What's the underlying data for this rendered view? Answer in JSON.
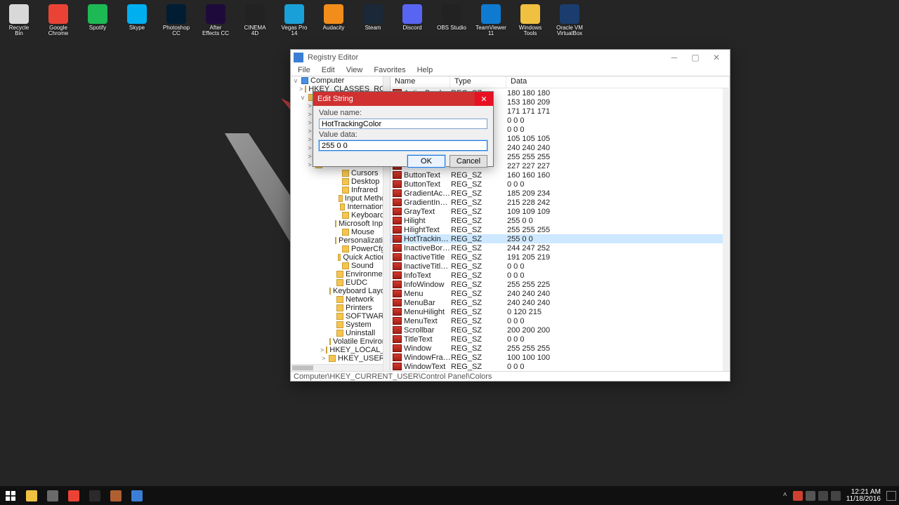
{
  "desktop_icons": [
    {
      "label": "Recycle Bin",
      "color": "#d8d8d8"
    },
    {
      "label": "Google Chrome",
      "color": "#ea4335"
    },
    {
      "label": "Spotify",
      "color": "#1db954"
    },
    {
      "label": "Skype",
      "color": "#00aff0"
    },
    {
      "label": "Photoshop CC",
      "color": "#001d34"
    },
    {
      "label": "After Effects CC",
      "color": "#1f0a3c"
    },
    {
      "label": "CINEMA 4D",
      "color": "#222"
    },
    {
      "label": "Vegas Pro 14",
      "color": "#1aa0d8"
    },
    {
      "label": "Audacity",
      "color": "#f28c1a"
    },
    {
      "label": "Steam",
      "color": "#1b2838"
    },
    {
      "label": "Discord",
      "color": "#5865f2"
    },
    {
      "label": "OBS Studio",
      "color": "#222"
    },
    {
      "label": "TeamViewer 11",
      "color": "#0e7bd1"
    },
    {
      "label": "Windows Tools",
      "color": "#f0c040"
    },
    {
      "label": "Oracle VM VirtualBox",
      "color": "#1a3d6e"
    }
  ],
  "window": {
    "title": "Registry Editor",
    "menu": [
      "File",
      "Edit",
      "View",
      "Favorites",
      "Help"
    ],
    "status": "Computer\\HKEY_CURRENT_USER\\Control Panel\\Colors",
    "columns": {
      "name": "Name",
      "type": "Type",
      "data": "Data"
    }
  },
  "tree": [
    {
      "ind": 0,
      "ex": "v",
      "label": "Computer",
      "cls": "computer"
    },
    {
      "ind": 1,
      "ex": ">",
      "label": "HKEY_CLASSES_ROOT"
    },
    {
      "ind": 1,
      "ex": "v",
      "label": ""
    },
    {
      "ind": 2,
      "ex": ">",
      "label": ""
    },
    {
      "ind": 2,
      "ex": ">",
      "label": ""
    },
    {
      "ind": 2,
      "ex": ">",
      "label": ""
    },
    {
      "ind": 2,
      "ex": ">",
      "label": ""
    },
    {
      "ind": 2,
      "ex": ">",
      "label": ""
    },
    {
      "ind": 2,
      "ex": ">",
      "label": ""
    },
    {
      "ind": 2,
      "ex": ">",
      "label": ""
    },
    {
      "ind": 2,
      "ex": ">",
      "label": ""
    },
    {
      "ind": 6,
      "ex": "",
      "label": "Cursors"
    },
    {
      "ind": 6,
      "ex": "",
      "label": "Desktop"
    },
    {
      "ind": 6,
      "ex": "",
      "label": "Infrared"
    },
    {
      "ind": 6,
      "ex": "",
      "label": "Input Method"
    },
    {
      "ind": 6,
      "ex": "",
      "label": "International"
    },
    {
      "ind": 6,
      "ex": "",
      "label": "Keyboard"
    },
    {
      "ind": 6,
      "ex": "",
      "label": "Microsoft Input D…"
    },
    {
      "ind": 6,
      "ex": "",
      "label": "Mouse"
    },
    {
      "ind": 6,
      "ex": "",
      "label": "Personalization"
    },
    {
      "ind": 6,
      "ex": "",
      "label": "PowerCfg"
    },
    {
      "ind": 6,
      "ex": "",
      "label": "Quick Actions"
    },
    {
      "ind": 6,
      "ex": "",
      "label": "Sound"
    },
    {
      "ind": 5,
      "ex": "",
      "label": "Environment"
    },
    {
      "ind": 5,
      "ex": "",
      "label": "EUDC"
    },
    {
      "ind": 5,
      "ex": "",
      "label": "Keyboard Layout"
    },
    {
      "ind": 5,
      "ex": "",
      "label": "Network"
    },
    {
      "ind": 5,
      "ex": "",
      "label": "Printers"
    },
    {
      "ind": 5,
      "ex": "",
      "label": "SOFTWARE"
    },
    {
      "ind": 5,
      "ex": "",
      "label": "System"
    },
    {
      "ind": 5,
      "ex": "",
      "label": "Uninstall"
    },
    {
      "ind": 5,
      "ex": "",
      "label": "Volatile Environment"
    },
    {
      "ind": 4,
      "ex": ">",
      "label": "HKEY_LOCAL_MACHINE"
    },
    {
      "ind": 4,
      "ex": ">",
      "label": "HKEY_USERS"
    }
  ],
  "rows": [
    {
      "name": "ActiveBorder",
      "type": "REG_SZ",
      "data": "180 180 180"
    },
    {
      "name": "",
      "type": "",
      "data": "153 180 209"
    },
    {
      "name": "",
      "type": "",
      "data": "171 171 171"
    },
    {
      "name": "",
      "type": "",
      "data": "0 0 0"
    },
    {
      "name": "",
      "type": "",
      "data": "0 0 0"
    },
    {
      "name": "",
      "type": "",
      "data": "105 105 105"
    },
    {
      "name": "",
      "type": "",
      "data": "240 240 240"
    },
    {
      "name": "",
      "type": "",
      "data": "255 255 255"
    },
    {
      "name": "",
      "type": "",
      "data": "227 227 227"
    },
    {
      "name": "ButtonText",
      "type": "REG_SZ",
      "data": "160 160 160"
    },
    {
      "name": "ButtonText",
      "type": "REG_SZ",
      "data": "0 0 0"
    },
    {
      "name": "GradientActiveT…",
      "type": "REG_SZ",
      "data": "185 209 234"
    },
    {
      "name": "GradientInactiv…",
      "type": "REG_SZ",
      "data": "215 228 242"
    },
    {
      "name": "GrayText",
      "type": "REG_SZ",
      "data": "109 109 109"
    },
    {
      "name": "Hilight",
      "type": "REG_SZ",
      "data": "255 0 0"
    },
    {
      "name": "HilightText",
      "type": "REG_SZ",
      "data": "255 255 255"
    },
    {
      "name": "HotTrackingColor",
      "type": "REG_SZ",
      "data": "255 0 0",
      "sel": true
    },
    {
      "name": "InactiveBorder",
      "type": "REG_SZ",
      "data": "244 247 252"
    },
    {
      "name": "InactiveTitle",
      "type": "REG_SZ",
      "data": "191 205 219"
    },
    {
      "name": "InactiveTitleText",
      "type": "REG_SZ",
      "data": "0 0 0"
    },
    {
      "name": "InfoText",
      "type": "REG_SZ",
      "data": "0 0 0"
    },
    {
      "name": "InfoWindow",
      "type": "REG_SZ",
      "data": "255 255 225"
    },
    {
      "name": "Menu",
      "type": "REG_SZ",
      "data": "240 240 240"
    },
    {
      "name": "MenuBar",
      "type": "REG_SZ",
      "data": "240 240 240"
    },
    {
      "name": "MenuHilight",
      "type": "REG_SZ",
      "data": "0 120 215"
    },
    {
      "name": "MenuText",
      "type": "REG_SZ",
      "data": "0 0 0"
    },
    {
      "name": "Scrollbar",
      "type": "REG_SZ",
      "data": "200 200 200"
    },
    {
      "name": "TitleText",
      "type": "REG_SZ",
      "data": "0 0 0"
    },
    {
      "name": "Window",
      "type": "REG_SZ",
      "data": "255 255 255"
    },
    {
      "name": "WindowFrame",
      "type": "REG_SZ",
      "data": "100 100 100"
    },
    {
      "name": "WindowText",
      "type": "REG_SZ",
      "data": "0 0 0"
    }
  ],
  "dialog": {
    "title": "Edit String",
    "value_name_label": "Value name:",
    "value_name": "HotTrackingColor",
    "value_data_label": "Value data:",
    "value_data": "255 0 0",
    "ok": "OK",
    "cancel": "Cancel"
  },
  "taskbar": {
    "apps": [
      {
        "name": "file-explorer-icon",
        "color": "#f0c040"
      },
      {
        "name": "snipping-icon",
        "color": "#6a6a6a"
      },
      {
        "name": "chrome-icon",
        "color": "#ea4335"
      },
      {
        "name": "obs-icon",
        "color": "#2a2a2a"
      },
      {
        "name": "app-icon",
        "color": "#b06030"
      },
      {
        "name": "regedit-icon",
        "color": "#3a7fd5"
      }
    ],
    "time": "12:21 AM",
    "date": "11/18/2016"
  }
}
